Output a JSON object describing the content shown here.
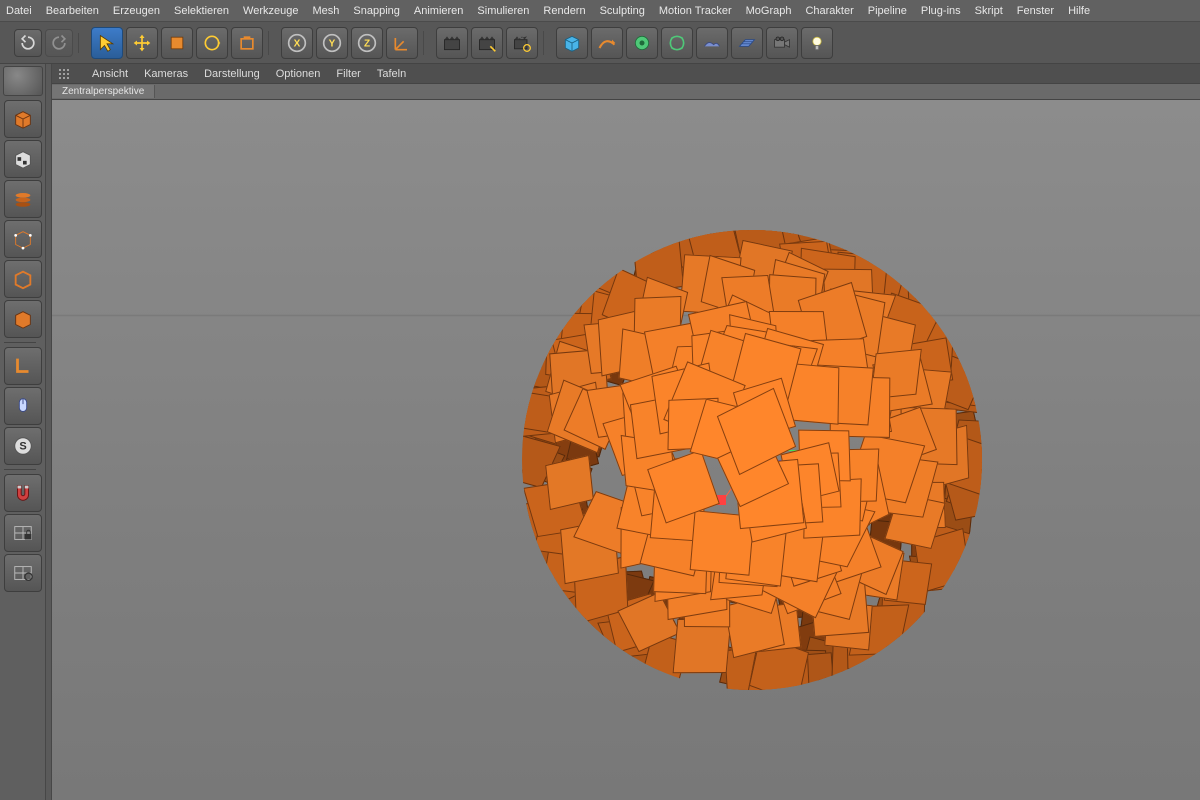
{
  "menu": [
    "Datei",
    "Bearbeiten",
    "Erzeugen",
    "Selektieren",
    "Werkzeuge",
    "Mesh",
    "Snapping",
    "Animieren",
    "Simulieren",
    "Rendern",
    "Sculpting",
    "Motion Tracker",
    "MoGraph",
    "Charakter",
    "Pipeline",
    "Plug-ins",
    "Skript",
    "Fenster",
    "Hilfe"
  ],
  "vp_menu": [
    "Ansicht",
    "Kameras",
    "Darstellung",
    "Optionen",
    "Filter",
    "Tafeln"
  ],
  "vp_tab": "Zentralperspektive",
  "toolbar": {
    "undo": "undo-icon",
    "redo": "redo-icon",
    "select": "arrow-icon",
    "move": "move-icon",
    "scale": "scale-icon",
    "rotate": "rotate-icon",
    "recent": "box-icon",
    "axis_x": "X",
    "axis_y": "Y",
    "axis_z": "Z",
    "coord": "coord-icon",
    "render": "clapper-icon",
    "render_region": "clapper-region-icon",
    "render_settings": "clapper-gear-icon",
    "add_cube": "cube-icon",
    "pen": "pen-icon",
    "deformer": "deformer-icon",
    "environment": "env-icon",
    "spline": "spline-icon",
    "floor": "floor-icon",
    "camera": "camera-icon",
    "light": "light-icon"
  },
  "palette": [
    {
      "name": "make-editable",
      "icon": "cube"
    },
    {
      "name": "model-mode",
      "icon": "cube-checker"
    },
    {
      "name": "texture-mode",
      "icon": "stack"
    },
    {
      "name": "points-mode",
      "icon": "cube-points"
    },
    {
      "name": "edges-mode",
      "icon": "cube-edges"
    },
    {
      "name": "polys-mode",
      "icon": "cube-poly"
    },
    {
      "name": "axis-mode",
      "icon": "L"
    },
    {
      "name": "tweak-mode",
      "icon": "mouse"
    },
    {
      "name": "snap-toggle",
      "icon": "S"
    },
    {
      "name": "magnet",
      "icon": "magnet"
    },
    {
      "name": "workplane",
      "icon": "grid-lock"
    },
    {
      "name": "viewport-solo",
      "icon": "grid-gear"
    }
  ],
  "colors": {
    "obj": "#d5691d",
    "obj_dark": "#bb5716",
    "obj_light": "#e87a27"
  }
}
